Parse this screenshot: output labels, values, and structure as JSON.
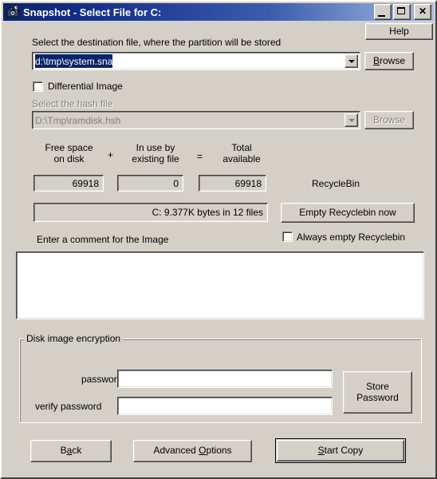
{
  "window": {
    "title": "Snapshot - Select File for C:",
    "icon": "camera-icon",
    "minimize_label": "_",
    "maximize_label": "[]",
    "close_label": "✕"
  },
  "help": {
    "label": "Help"
  },
  "destination": {
    "prompt": "Select the destination file, where the partition will be stored",
    "path_value": "d:\\tmp\\system.sna",
    "browse_label_pre": "B",
    "browse_label_post": "rowse"
  },
  "differential": {
    "checkbox_label": "Differential Image",
    "checked": false,
    "hash_prompt": "Select the hash file",
    "hash_value": "D:\\Tmp\\ramdisk.hsh",
    "hash_browse_label": "Browse",
    "disabled": true
  },
  "space": {
    "free_label_line1": "Free space",
    "free_label_line2": "on disk",
    "plus_sign": "+",
    "inuse_label_line1": "In use by",
    "inuse_label_line2": "existing file",
    "equals_sign": "=",
    "total_label_line1": "Total",
    "total_label_line2": "available",
    "free_value": "69918",
    "inuse_value": "0",
    "total_value": "69918",
    "status_text": "C: 9.377K bytes in 12 files"
  },
  "recyclebin": {
    "title": "RecycleBin",
    "empty_button": "Empty Recyclebin now",
    "always_empty_label": "Always empty Recyclebin",
    "always_empty_checked": false
  },
  "comment": {
    "prompt": "Enter a comment for the Image",
    "value": ""
  },
  "encryption": {
    "group_title": "Disk image encryption",
    "password_label": "password",
    "password_value": "",
    "verify_label": "verify password",
    "verify_value": "",
    "store_button_line1": "Store",
    "store_button_line2": "Password"
  },
  "footer": {
    "back_pre": "B",
    "back_accel": "a",
    "back_post": "ck",
    "advanced_pre": "Advanced ",
    "advanced_accel": "O",
    "advanced_post": "ptions",
    "start_accel": "S",
    "start_post": "tart Copy"
  },
  "colors": {
    "face": "#d4d0c8",
    "title_dark": "#0a246a",
    "title_light": "#a6bce2",
    "selection": "#0a246a",
    "disabled_text": "#808080"
  }
}
